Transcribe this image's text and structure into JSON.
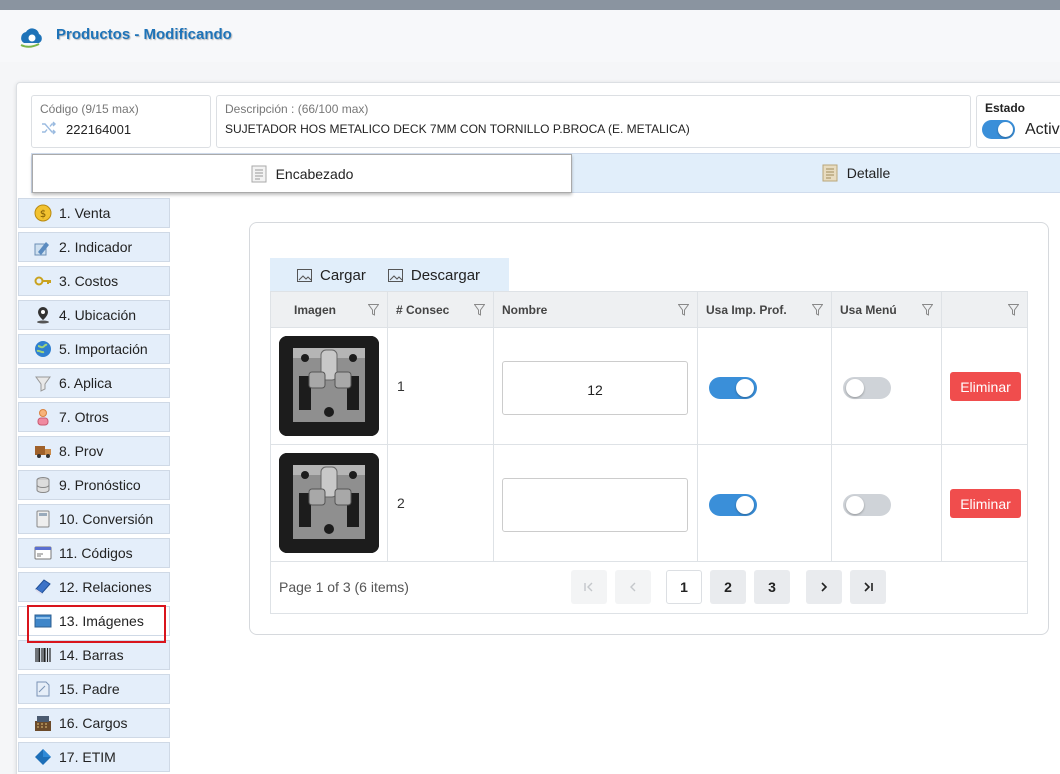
{
  "window": {
    "title": "Productos - Modificando"
  },
  "header_fields": {
    "code_label": "Código (9/15 max)",
    "code_value": "222164001",
    "description_label": "Descripción : (66/100 max)",
    "description_value": "SUJETADOR HOS METALICO DECK 7MM CON TORNILLO P.BROCA (E. METALICA)",
    "state_label": "Estado",
    "state_value": "Activ",
    "state_active": true
  },
  "tabs": [
    {
      "label": "Encabezado",
      "active": true
    },
    {
      "label": "Detalle",
      "active": false
    }
  ],
  "side_menu": [
    {
      "label": "1. Venta",
      "icon": "coin-icon"
    },
    {
      "label": "2. Indicador",
      "icon": "chart-pencil-icon"
    },
    {
      "label": "3. Costos",
      "icon": "keys-icon"
    },
    {
      "label": "4. Ubicación",
      "icon": "location-pin-icon"
    },
    {
      "label": "5. Importación",
      "icon": "globe-icon"
    },
    {
      "label": "6. Aplica",
      "icon": "funnel-icon"
    },
    {
      "label": "7. Otros",
      "icon": "person-icon"
    },
    {
      "label": "8. Prov",
      "icon": "truck-icon"
    },
    {
      "label": "9. Pronóstico",
      "icon": "database-icon"
    },
    {
      "label": "10. Conversión",
      "icon": "calculator-icon"
    },
    {
      "label": "11. Códigos",
      "icon": "card-icon"
    },
    {
      "label": "12. Relaciones",
      "icon": "book-icon"
    },
    {
      "label": "13. Imágenes",
      "icon": "picture-icon",
      "selected": true
    },
    {
      "label": "14. Barras",
      "icon": "barcode-icon"
    },
    {
      "label": "15. Padre",
      "icon": "document-icon"
    },
    {
      "label": "16. Cargos",
      "icon": "register-icon"
    },
    {
      "label": "17. ETIM",
      "icon": "diamond-icon"
    }
  ],
  "toolbar": {
    "upload_label": "Cargar",
    "download_label": "Descargar"
  },
  "grid": {
    "columns": [
      "Imagen",
      "# Consec",
      "Nombre",
      "Usa Imp. Prof.",
      "Usa Menú",
      ""
    ],
    "rows": [
      {
        "consec": "1",
        "name": "12",
        "usa_imp_prof": true,
        "usa_menu": false,
        "delete_label": "Eliminar"
      },
      {
        "consec": "2",
        "name": "",
        "usa_imp_prof": true,
        "usa_menu": false,
        "delete_label": "Eliminar"
      }
    ]
  },
  "pager": {
    "info": "Page 1 of 3 (6 items)",
    "pages": [
      "1",
      "2",
      "3"
    ],
    "current_page": "1"
  },
  "colors": {
    "accent": "#1e73b8",
    "toggle_on": "#3a8fd9",
    "delete": "#f04d4d",
    "highlight": "#d9141c"
  }
}
